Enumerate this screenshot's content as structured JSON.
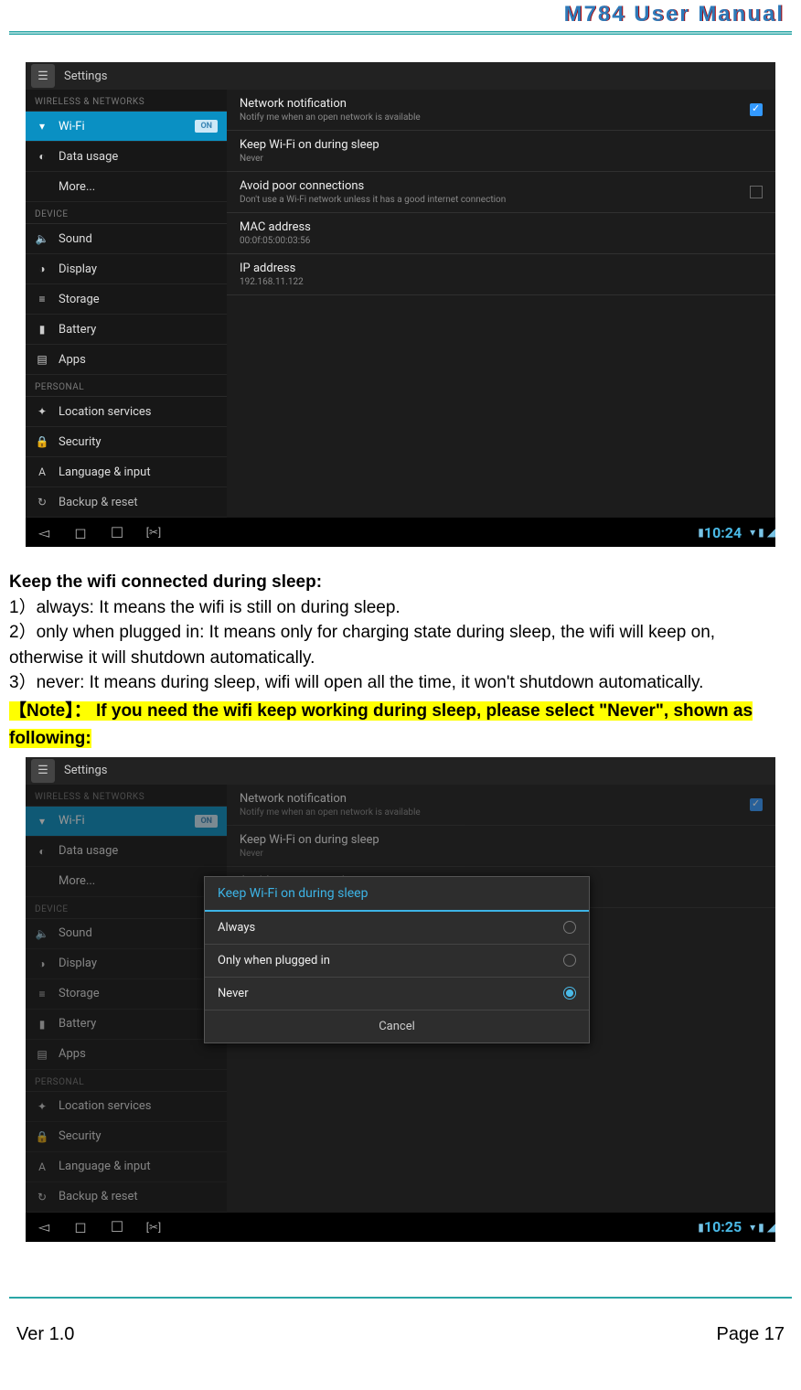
{
  "doc": {
    "header_title": "M784  User  Manual",
    "version": "Ver 1.0",
    "page": "Page 17"
  },
  "android_header": {
    "app_title": "Settings",
    "on_label": "ON"
  },
  "categories": {
    "wireless": "WIRELESS & NETWORKS",
    "device": "DEVICE",
    "personal": "PERSONAL"
  },
  "sidebar_items": {
    "wifi": "Wi-Fi",
    "data": "Data usage",
    "more": "More...",
    "sound": "Sound",
    "display": "Display",
    "storage": "Storage",
    "battery": "Battery",
    "apps": "Apps",
    "location": "Location services",
    "security": "Security",
    "language": "Language & input",
    "backup": "Backup & reset"
  },
  "adv_rows": {
    "network_notif": {
      "label": "Network notification",
      "sub": "Notify me when an open network is available"
    },
    "keep_wifi": {
      "label": "Keep Wi-Fi on during sleep",
      "sub": "Never"
    },
    "avoid_poor": {
      "label": "Avoid poor connections",
      "sub": "Don't use a Wi-Fi network unless it has a good internet connection"
    },
    "mac": {
      "label": "MAC address",
      "sub": "00:0f:05:00:03:56"
    },
    "ip": {
      "label": "IP address",
      "sub": "192.168.11.122"
    }
  },
  "fig1_time": "10:24",
  "fig2_time": "10:25",
  "dialog": {
    "title": "Keep Wi-Fi on during sleep",
    "opt1": "Always",
    "opt2": "Only when plugged in",
    "opt3": "Never",
    "cancel": "Cancel"
  },
  "text": {
    "heading1": "Keep the wifi connected during sleep:",
    "p1": "1）always: It means the wifi is still on during sleep.",
    "p2": "2）only when plugged in: It means only for charging state during sleep, the wifi will keep on, otherwise it will shutdown automatically.",
    "p3": "3）never: It means during sleep, wifi will open all the time, it won't shutdown automatically.",
    "note": "【Note】： If you need the wifi keep working during sleep, please select \"Never\", shown as following:"
  }
}
